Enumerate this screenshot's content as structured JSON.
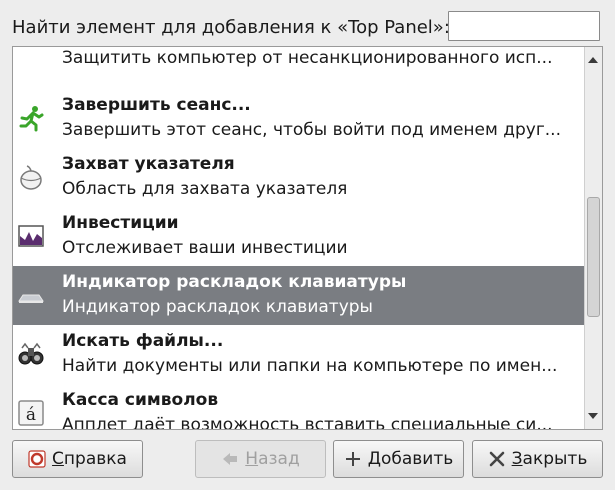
{
  "search": {
    "label": "Найти элемент для добавления к «Top Panel»:",
    "value": "",
    "placeholder": ""
  },
  "items": [
    {
      "name": "",
      "desc": "Защитить компьютер от несанкционированного исп...",
      "icon": "lock-icon"
    },
    {
      "name": "Завершить сеанс...",
      "desc": "Завершить этот сеанс, чтобы войти под именем друг...",
      "icon": "running-man-icon"
    },
    {
      "name": "Захват указателя",
      "desc": "Область для захвата указателя",
      "icon": "mouse-icon"
    },
    {
      "name": "Инвестиции",
      "desc": "Отслеживает ваши инвестиции",
      "icon": "chart-icon"
    },
    {
      "name": "Индикатор раскладок клавиатуры",
      "desc": "Индикатор раскладок клавиатуры",
      "icon": "keyboard-icon"
    },
    {
      "name": "Искать файлы...",
      "desc": "Найти документы или папки на компьютере по имен...",
      "icon": "binoculars-icon"
    },
    {
      "name": "Касса символов",
      "desc": "Апплет даёт возможность вставить специальные си...",
      "icon": "character-icon"
    }
  ],
  "selected_index": 4,
  "char_glyph": "á",
  "buttons": {
    "help": {
      "pre": "",
      "u": "С",
      "post": "правка"
    },
    "back": {
      "pre": "",
      "u": "Н",
      "post": "азад"
    },
    "add": {
      "pre": "",
      "u": "Д",
      "post": "обавить"
    },
    "close": {
      "pre": "",
      "u": "З",
      "post": "акрыть"
    }
  },
  "colors": {
    "selection": "#7a7d82",
    "accent_green": "#3aa52a"
  }
}
